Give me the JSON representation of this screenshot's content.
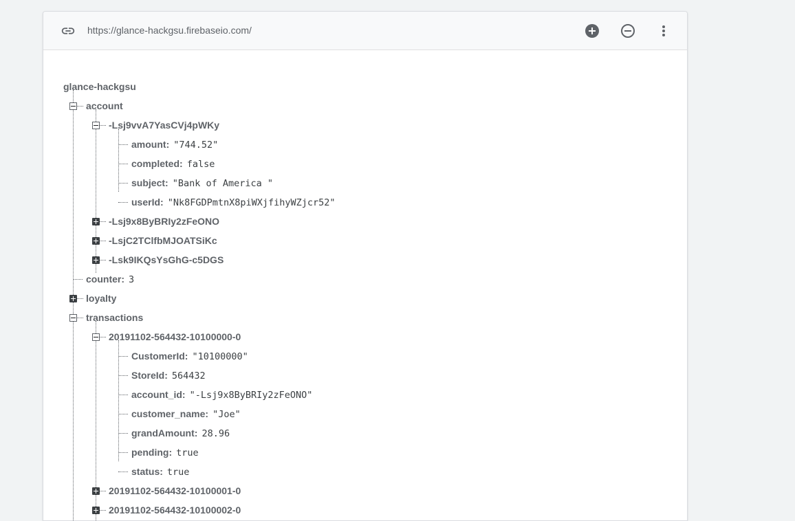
{
  "header": {
    "url": "https://glance-hackgsu.firebaseio.com/",
    "icons": [
      "link-icon",
      "add-circle-icon",
      "remove-circle-icon",
      "more-vert-icon"
    ]
  },
  "tree": {
    "root": "glance-hackgsu",
    "account": {
      "key": "account",
      "entry1": {
        "key": "-Lsj9vvA7YasCVj4pWKy",
        "amount": {
          "key": "amount",
          "value": "\"744.52\""
        },
        "completed": {
          "key": "completed",
          "value": "false"
        },
        "subject": {
          "key": "subject",
          "value": "\"Bank of America \""
        },
        "userId": {
          "key": "userId",
          "value": "\"Nk8FGDPmtnX8piWXjfihyWZjcr52\""
        }
      },
      "entry2": "-Lsj9x8ByBRIy2zFeONO",
      "entry3": "-LsjC2TClfbMJOATSiKc",
      "entry4": "-Lsk9IKQsYsGhG-c5DGS"
    },
    "counter": {
      "key": "counter",
      "value": "3"
    },
    "loyalty": "loyalty",
    "transactions": {
      "key": "transactions",
      "tx1": {
        "key": "20191102-564432-10100000-0",
        "CustomerId": {
          "key": "CustomerId",
          "value": "\"10100000\""
        },
        "StoreId": {
          "key": "StoreId",
          "value": "564432"
        },
        "account_id": {
          "key": "account_id",
          "value": "\"-Lsj9x8ByBRIy2zFeONO\""
        },
        "customer_name": {
          "key": "customer_name",
          "value": "\"Joe\""
        },
        "grandAmount": {
          "key": "grandAmount",
          "value": "28.96"
        },
        "pending": {
          "key": "pending",
          "value": "true"
        },
        "status": {
          "key": "status",
          "value": "true"
        }
      },
      "tx2": "20191102-564432-10100001-0",
      "tx3": "20191102-564432-10100002-0"
    }
  }
}
